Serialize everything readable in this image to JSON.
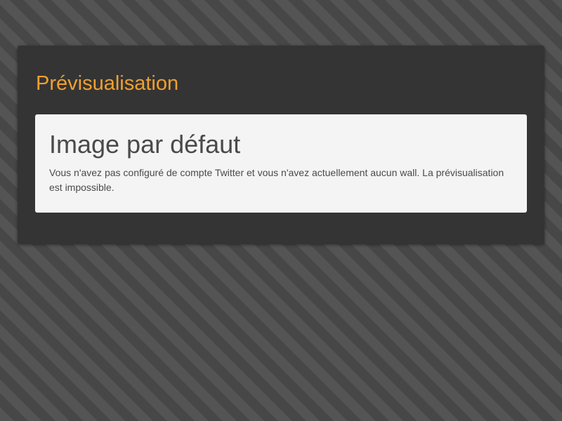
{
  "panel": {
    "title": "Prévisualisation"
  },
  "preview": {
    "heading": "Image par défaut",
    "message": "Vous n'avez pas configuré de compte Twitter et vous n'avez actuellement aucun wall. La prévisualisation est impossible."
  },
  "colors": {
    "accent": "#f0a030",
    "panel_background": "#343434",
    "box_background": "#f4f4f4",
    "text": "#4a4a4a"
  }
}
